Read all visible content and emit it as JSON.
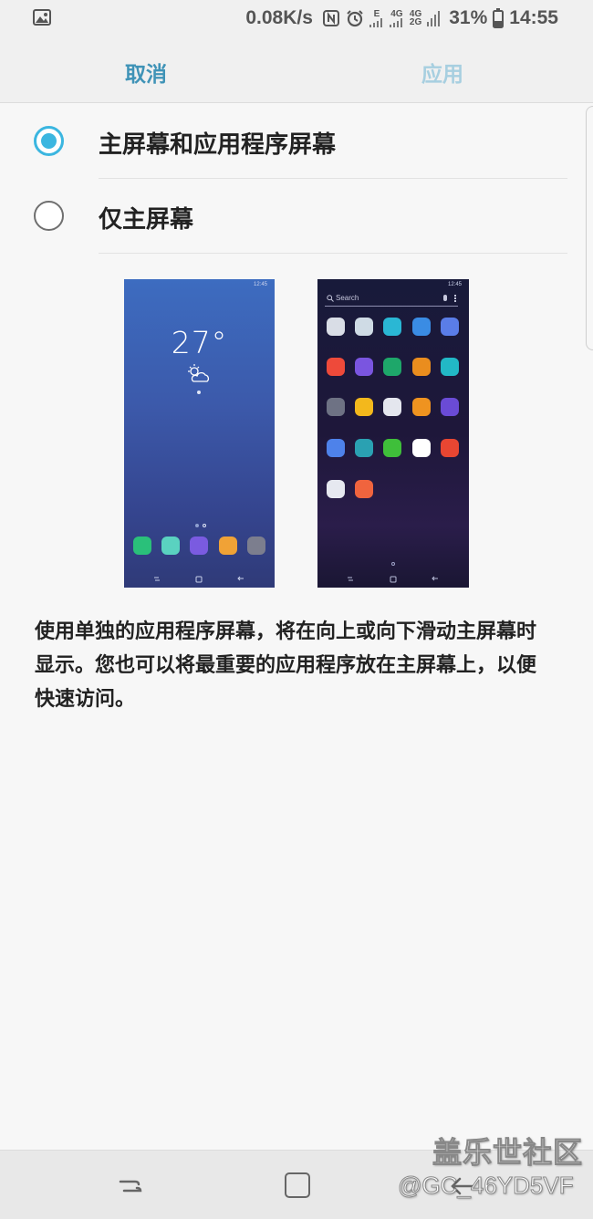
{
  "status_bar": {
    "net_speed": "0.08K/s",
    "net_type_1_top": "E",
    "net_type_2_top": "4G",
    "net_type_3_top": "4G",
    "net_type_3_bottom": "2G",
    "battery_percent": "31%",
    "time": "14:55",
    "icons": [
      "gallery-icon",
      "nfc-icon",
      "alarm-icon",
      "signal-icon",
      "battery-icon"
    ]
  },
  "action_bar": {
    "cancel_label": "取消",
    "apply_label": "应用",
    "cancel_color": "#3f93b7",
    "apply_color": "#a7cfe0"
  },
  "options": [
    {
      "label": "主屏幕和应用程序屏幕",
      "selected": true
    },
    {
      "label": "仅主屏幕",
      "selected": false
    }
  ],
  "preview": {
    "home": {
      "clock": "27°",
      "mini_time": "12:45"
    },
    "apps": {
      "search_placeholder": "Search",
      "mini_time": "12:45"
    }
  },
  "description": "使用单独的应用程序屏幕，将在向上或向下滑动主屏幕时显示。您也可以将最重要的应用程序放在主屏幕上，以便快速访问。",
  "watermark": {
    "brand": "盖乐世社区",
    "user": "@GC_46YD5VF"
  },
  "accent_color": "#3bb6e0"
}
